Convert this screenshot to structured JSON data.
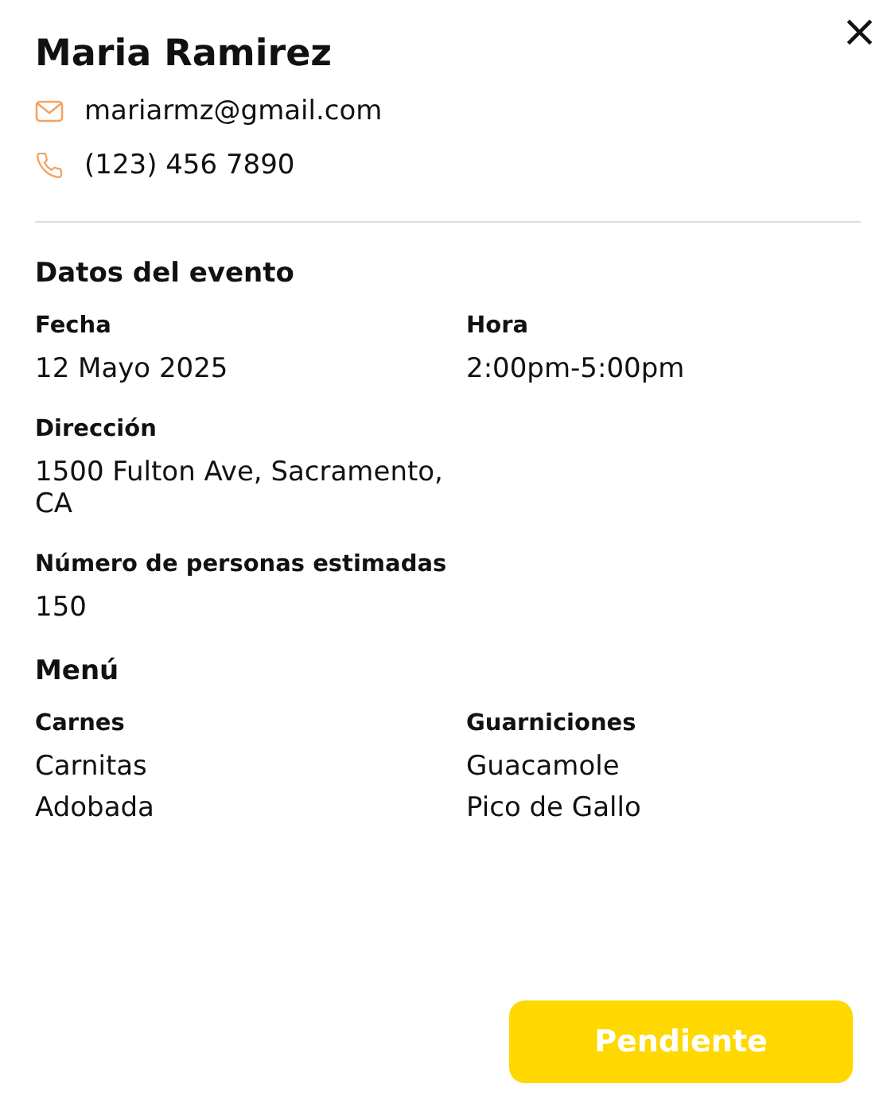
{
  "contact": {
    "name": "Maria Ramirez",
    "email": "mariarmz@gmail.com",
    "phone": "(123) 456 7890"
  },
  "close": "×",
  "event": {
    "title": "Datos del evento",
    "rows": [
      [
        {
          "label": "Fecha",
          "value": "12 Mayo 2025"
        },
        {
          "label": "Hora",
          "value": "2:00pm-5:00pm"
        }
      ],
      [
        {
          "label": "Dirección",
          "value": "1500 Fulton Ave, Sacramento, CA"
        }
      ],
      [
        {
          "label": "Número de personas estimadas",
          "value": "150"
        }
      ]
    ]
  },
  "menu": {
    "title": "Menú",
    "columns": [
      {
        "label": "Carnes",
        "items": [
          "Carnitas",
          "Adobada"
        ]
      },
      {
        "label": "Guarniciones",
        "items": [
          "Guacamole",
          "Pico de Gallo"
        ]
      }
    ]
  },
  "status": {
    "label": "Pendiente",
    "kind": "pending"
  }
}
